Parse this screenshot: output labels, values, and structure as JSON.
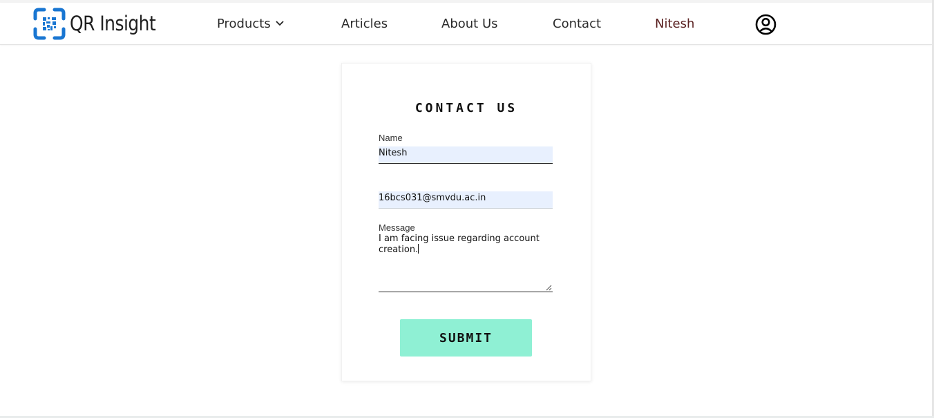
{
  "header": {
    "brand": "QR Insight",
    "nav": {
      "products": "Products",
      "articles": "Articles",
      "about": "About Us",
      "contact": "Contact",
      "user": "Nitesh"
    },
    "profile_icon": "user-circle-icon"
  },
  "form": {
    "title": "CONTACT US",
    "name_label": "Name",
    "name_value": "Nitesh",
    "email_value": "16bcs031@smvdu.ac.in",
    "message_label": "Message",
    "message_value": "I am facing issue regarding account creation.",
    "submit_label": "SUBMIT"
  },
  "colors": {
    "brand_blue": "#1976d2",
    "autofill_bg": "#e8f0fe",
    "submit_bg": "#8ff0d4"
  }
}
